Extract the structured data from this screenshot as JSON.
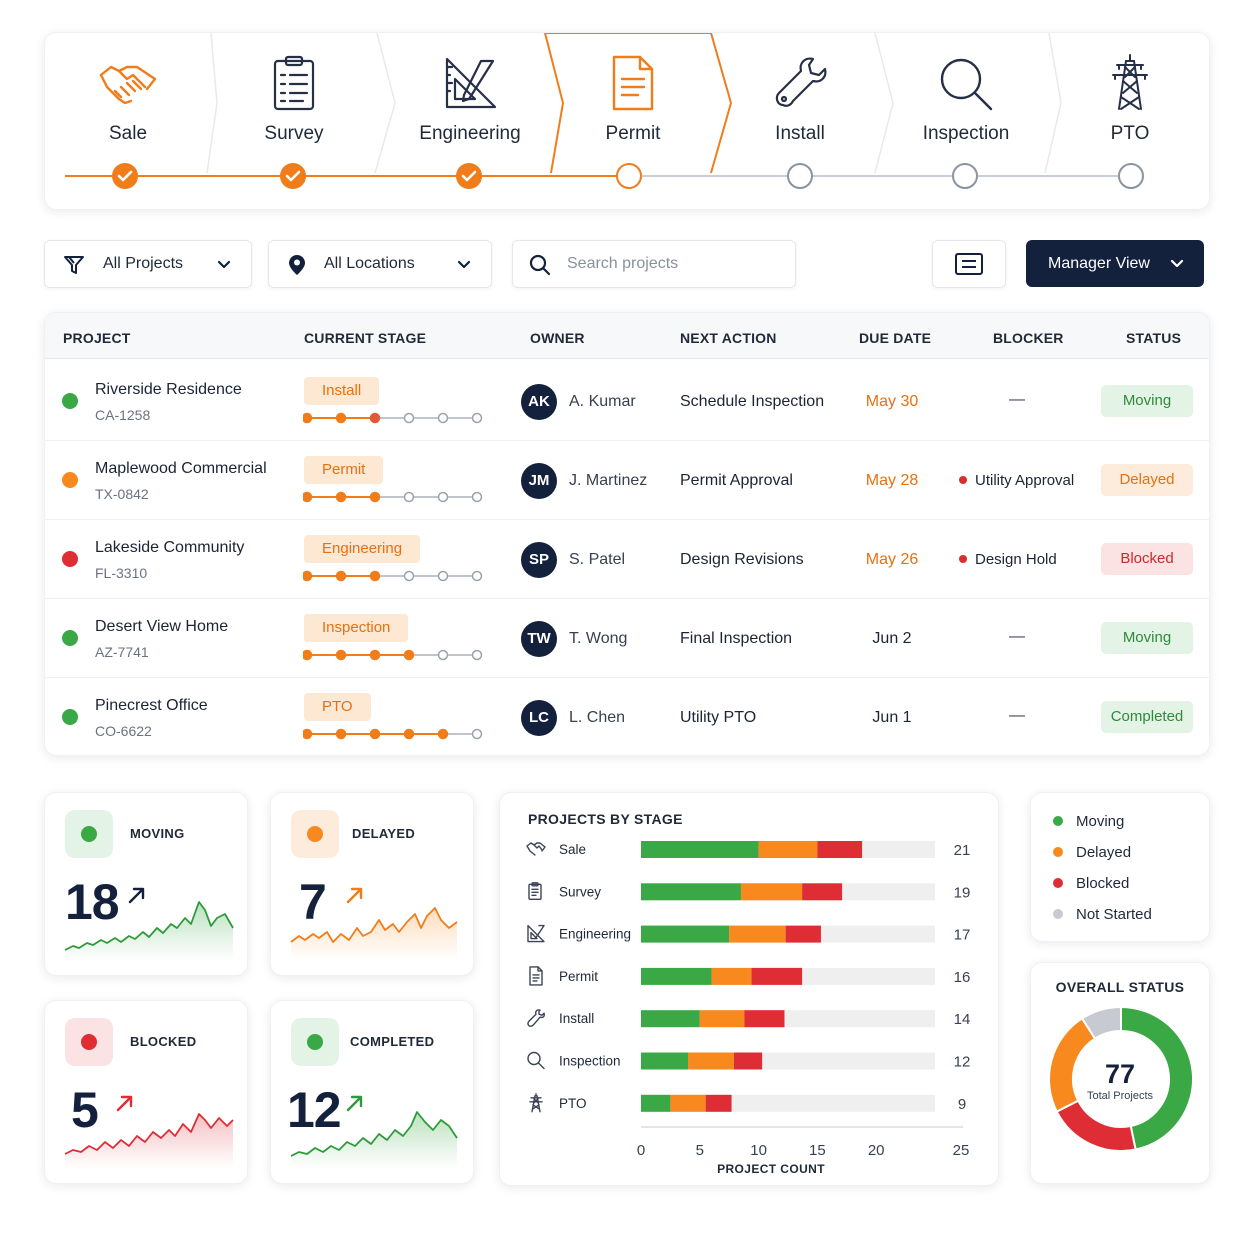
{
  "colors": {
    "accent": "#f07c1a",
    "navy": "#14213d",
    "moving": "#3aa845",
    "delayed": "#f7891f",
    "blocked": "#df2d35",
    "not_started": "#c7cbd1",
    "pending": "#8a93a0"
  },
  "pipeline": [
    {
      "label": "Sale",
      "icon": "handshake-icon",
      "state": "done"
    },
    {
      "label": "Survey",
      "icon": "clipboard-icon",
      "state": "done"
    },
    {
      "label": "Engineering",
      "icon": "drafting-triangle-icon",
      "state": "done"
    },
    {
      "label": "Permit",
      "icon": "document-icon",
      "state": "current"
    },
    {
      "label": "Install",
      "icon": "wrench-icon",
      "state": "todo"
    },
    {
      "label": "Inspection",
      "icon": "magnifier-icon",
      "state": "todo"
    },
    {
      "label": "PTO",
      "icon": "power-tower-icon",
      "state": "todo"
    }
  ],
  "filters": {
    "projects": "All Projects",
    "locations": "All Locations",
    "search_placeholder": "Search projects",
    "view": "Manager View"
  },
  "table": {
    "headers": [
      "PROJECT",
      "CURRENT STAGE",
      "OWNER",
      "NEXT ACTION",
      "DUE DATE",
      "BLOCKER",
      "STATUS"
    ],
    "rows": [
      {
        "dot": "moving",
        "name": "Riverside Residence",
        "id": "CA-1258",
        "stage": "Install",
        "progress": 3,
        "initials": "AK",
        "owner": "A. Kumar",
        "next": "Schedule Inspection",
        "due": "May 30",
        "due_highlight": true,
        "blocker": "—",
        "status": "Moving"
      },
      {
        "dot": "delayed",
        "name": "Maplewood Commercial",
        "id": "TX-0842",
        "stage": "Permit",
        "progress": 3,
        "initials": "JM",
        "owner": "J. Martinez",
        "next": "Permit Approval",
        "due": "May 28",
        "due_highlight": true,
        "blocker": "Utility Approval",
        "status": "Delayed"
      },
      {
        "dot": "blocked",
        "name": "Lakeside Community",
        "id": "FL-3310",
        "stage": "Engineering",
        "progress": 3,
        "initials": "SP",
        "owner": "S. Patel",
        "next": "Design Revisions",
        "due": "May 26",
        "due_highlight": true,
        "blocker": "Design Hold",
        "status": "Blocked"
      },
      {
        "dot": "moving",
        "name": "Desert View Home",
        "id": "AZ-7741",
        "stage": "Inspection",
        "progress": 4,
        "initials": "TW",
        "owner": "T. Wong",
        "next": "Final Inspection",
        "due": "Jun 2",
        "due_highlight": false,
        "blocker": "—",
        "status": "Moving"
      },
      {
        "dot": "moving",
        "name": "Pinecrest Office",
        "id": "CO-6622",
        "stage": "PTO",
        "progress": 5,
        "initials": "LC",
        "owner": "L. Chen",
        "next": "Utility PTO",
        "due": "Jun 1",
        "due_highlight": false,
        "blocker": "—",
        "status": "Completed"
      }
    ]
  },
  "metrics": [
    {
      "label": "MOVING",
      "value": "18",
      "kind": "moving"
    },
    {
      "label": "DELAYED",
      "value": "7",
      "kind": "delayed"
    },
    {
      "label": "BLOCKED",
      "value": "5",
      "kind": "blocked"
    },
    {
      "label": "COMPLETED",
      "value": "12",
      "kind": "moving"
    }
  ],
  "legend": [
    {
      "label": "Moving",
      "color": "#3aa845"
    },
    {
      "label": "Delayed",
      "color": "#f7891f"
    },
    {
      "label": "Blocked",
      "color": "#df2d35"
    },
    {
      "label": "Not Started",
      "color": "#c7cbd1"
    }
  ],
  "donut": {
    "title": "OVERALL STATUS",
    "total": "77",
    "subtitle": "Total Projects",
    "segments": [
      {
        "name": "Moving",
        "value": 36
      },
      {
        "name": "Blocked",
        "value": 16
      },
      {
        "name": "Delayed",
        "value": 18
      },
      {
        "name": "Not Started",
        "value": 7
      }
    ]
  },
  "chart_data": {
    "type": "bar",
    "orientation": "horizontal",
    "stacked": true,
    "title": "PROJECTS BY STAGE",
    "xlabel": "PROJECT COUNT",
    "xlim": [
      0,
      25
    ],
    "xticks": [
      0,
      5,
      10,
      15,
      20,
      25
    ],
    "categories": [
      "Sale",
      "Survey",
      "Engineering",
      "Permit",
      "Install",
      "Inspection",
      "PTO"
    ],
    "category_icons": [
      "handshake-icon",
      "clipboard-icon",
      "drafting-triangle-icon",
      "document-icon",
      "wrench-icon",
      "magnifier-icon",
      "power-tower-icon"
    ],
    "series": [
      {
        "name": "Moving",
        "values": [
          10,
          8.5,
          7.5,
          6,
          5,
          4,
          2.5
        ]
      },
      {
        "name": "Delayed",
        "values": [
          5,
          5.2,
          4.8,
          3.4,
          3.8,
          3.9,
          3
        ]
      },
      {
        "name": "Blocked",
        "values": [
          3.8,
          3.4,
          3,
          4.3,
          3.4,
          2.4,
          2.2
        ]
      }
    ],
    "totals": [
      21,
      19,
      17,
      16,
      14,
      12,
      9
    ]
  }
}
